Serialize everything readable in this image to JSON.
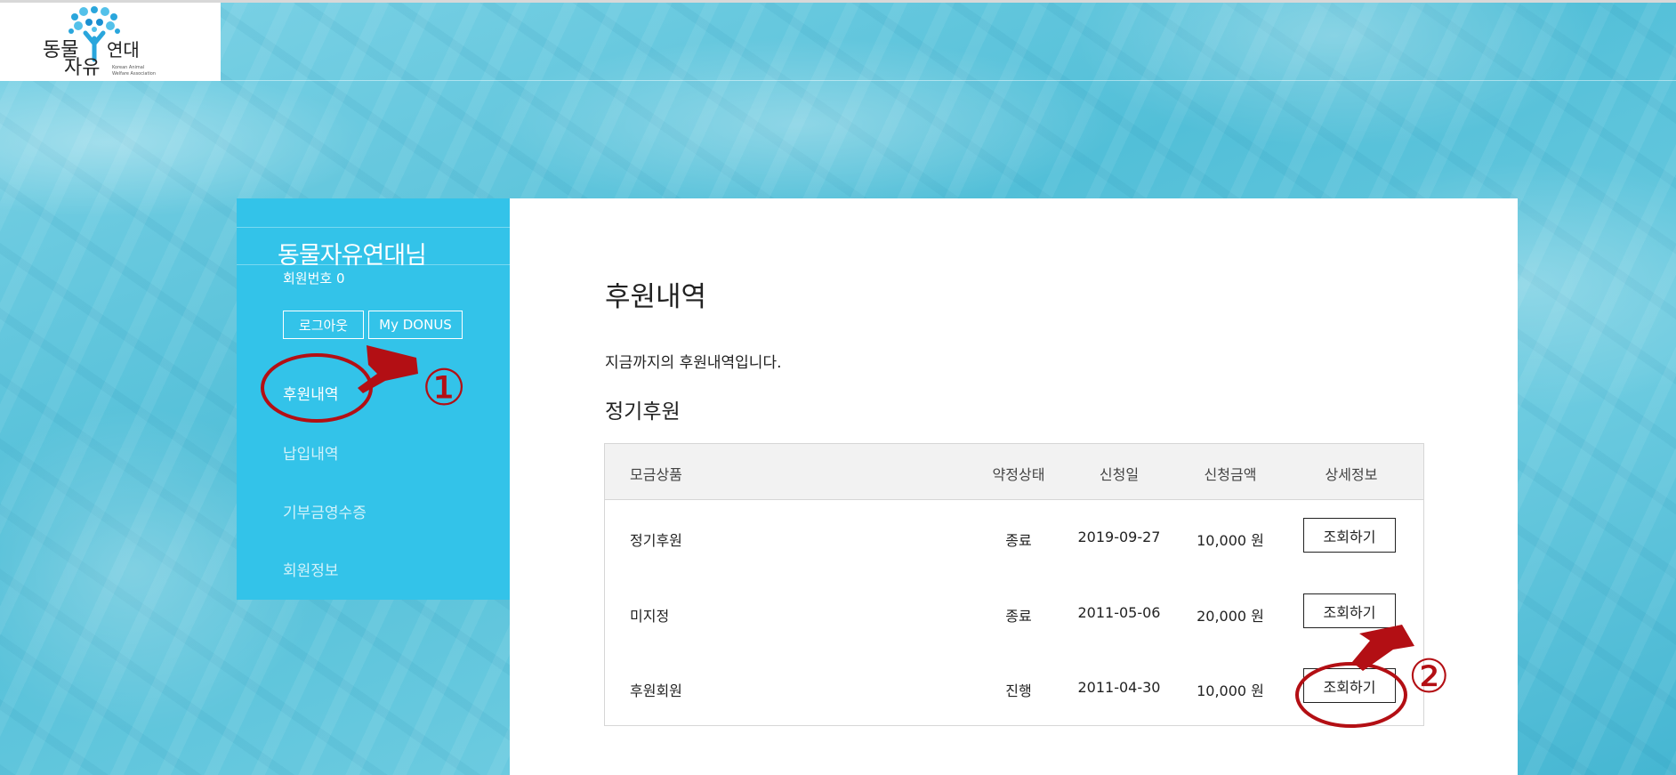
{
  "logo": {
    "title_line1": "동물",
    "title_line1b": "연대",
    "title_line2": "자유",
    "subtitle_line1": "Korean Animal",
    "subtitle_line2": "Welfare Association"
  },
  "sidebar": {
    "user_name": "동물자유연대님",
    "member_number": "회원번호 0",
    "logout_label": "로그아웃",
    "mydonus_label": "My DONUS",
    "items": [
      {
        "label": "후원내역",
        "active": true
      },
      {
        "label": "납입내역",
        "active": false
      },
      {
        "label": "기부금영수증",
        "active": false
      },
      {
        "label": "회원정보",
        "active": false
      }
    ]
  },
  "main": {
    "title": "후원내역",
    "intro": "지금까지의 후원내역입니다.",
    "section_title": "정기후원",
    "table": {
      "headers": {
        "product": "모금상품",
        "status": "약정상태",
        "date": "신청일",
        "amount": "신청금액",
        "detail": "상세정보"
      },
      "rows": [
        {
          "product": "정기후원",
          "status": "종료",
          "date": "2019-09-27",
          "amount": "10,000 원",
          "detail_label": "조회하기"
        },
        {
          "product": "미지정",
          "status": "종료",
          "date": "2011-05-06",
          "amount": "20,000 원",
          "detail_label": "조회하기"
        },
        {
          "product": "후원회원",
          "status": "진행",
          "date": "2011-04-30",
          "amount": "10,000 원",
          "detail_label": "조회하기"
        }
      ]
    }
  },
  "annotations": {
    "step1_label": "①",
    "step2_label": "②",
    "color": "#b30f14"
  },
  "colors": {
    "sidebar_bg": "#33c3e9",
    "logo_blue": "#1a8fd1"
  }
}
